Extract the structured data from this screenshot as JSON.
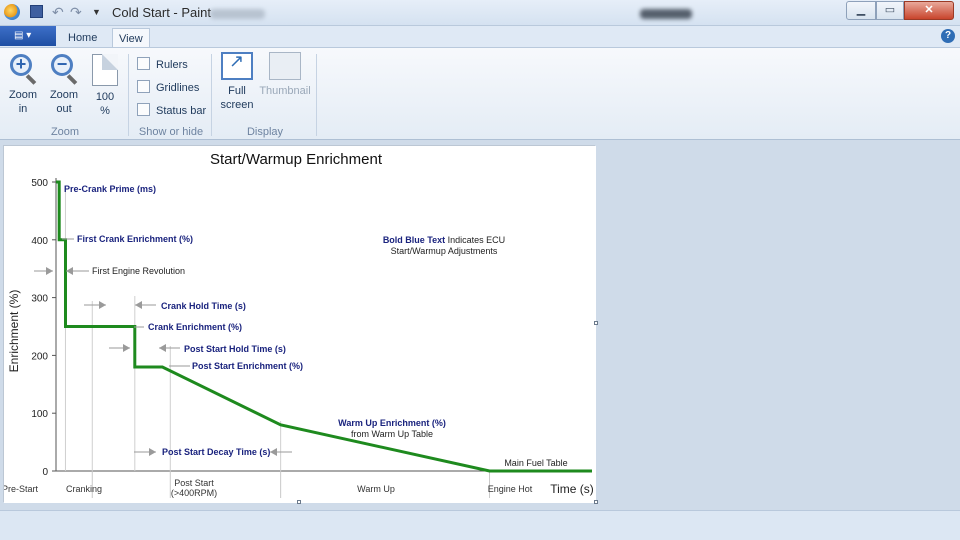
{
  "window": {
    "title": "Cold Start - Paint"
  },
  "tabs": [
    "Home",
    "View"
  ],
  "ribbon": {
    "zoom_in": "Zoom\nin",
    "zoom_out": "Zoom\nout",
    "zoom_100": "100\n%",
    "zoom_group": "Zoom",
    "rulers": "Rulers",
    "gridlines": "Gridlines",
    "status_bar": "Status bar",
    "show_group": "Show or hide",
    "full_screen": "Full\nscreen",
    "thumbnail": "Thumbnail",
    "display_group": "Display"
  },
  "chart_data": {
    "type": "line",
    "title": "Start/Warmup Enrichment",
    "ylabel": "Enrichment (%)",
    "xlabel": "Time (s)",
    "ylim": [
      0,
      500
    ],
    "yticks": [
      0,
      100,
      200,
      300,
      400,
      500
    ],
    "grid": false,
    "x_phases": [
      "Pre-Start",
      "Cranking",
      "Post Start\n(>400RPM)",
      "Warm Up",
      "Engine Hot"
    ],
    "series": [
      {
        "color": "#1e8a1e",
        "points": [
          [
            0,
            500
          ],
          [
            0.4,
            500
          ],
          [
            0.4,
            400
          ],
          [
            1.2,
            400
          ],
          [
            1.2,
            250
          ],
          [
            10,
            250
          ],
          [
            10,
            180
          ],
          [
            13.5,
            180
          ],
          [
            28.5,
            80
          ],
          [
            55,
            0
          ],
          [
            68,
            0
          ]
        ]
      }
    ],
    "annotations": [
      {
        "text": "Pre-Crank Prime (ms)",
        "bold": true
      },
      {
        "text": "First Crank Enrichment (%)",
        "bold": true
      },
      {
        "text": "First Engine Revolution",
        "bold": false
      },
      {
        "text": "Crank Hold Time (s)",
        "bold": true
      },
      {
        "text": "Crank Enrichment (%)",
        "bold": true
      },
      {
        "text": "Post Start Hold Time (s)",
        "bold": true
      },
      {
        "text": "Post Start Enrichment (%)",
        "bold": true
      },
      {
        "text": "Warm Up Enrichment (%)",
        "bold": true
      },
      {
        "text": "from Warm Up Table",
        "bold": false
      },
      {
        "text": "Post Start Decay Time (s)",
        "bold": true
      },
      {
        "text": "Main Fuel Table",
        "bold": false
      }
    ],
    "note": {
      "bold_part": "Bold Blue Text",
      "rest_line1": " Indicates ECU",
      "line2": "Start/Warmup Adjustments"
    },
    "colors": {
      "line": "#1e8a1e",
      "annotation": "#1a237e",
      "text": "#222222",
      "arrow": "#9a9a9a"
    }
  }
}
